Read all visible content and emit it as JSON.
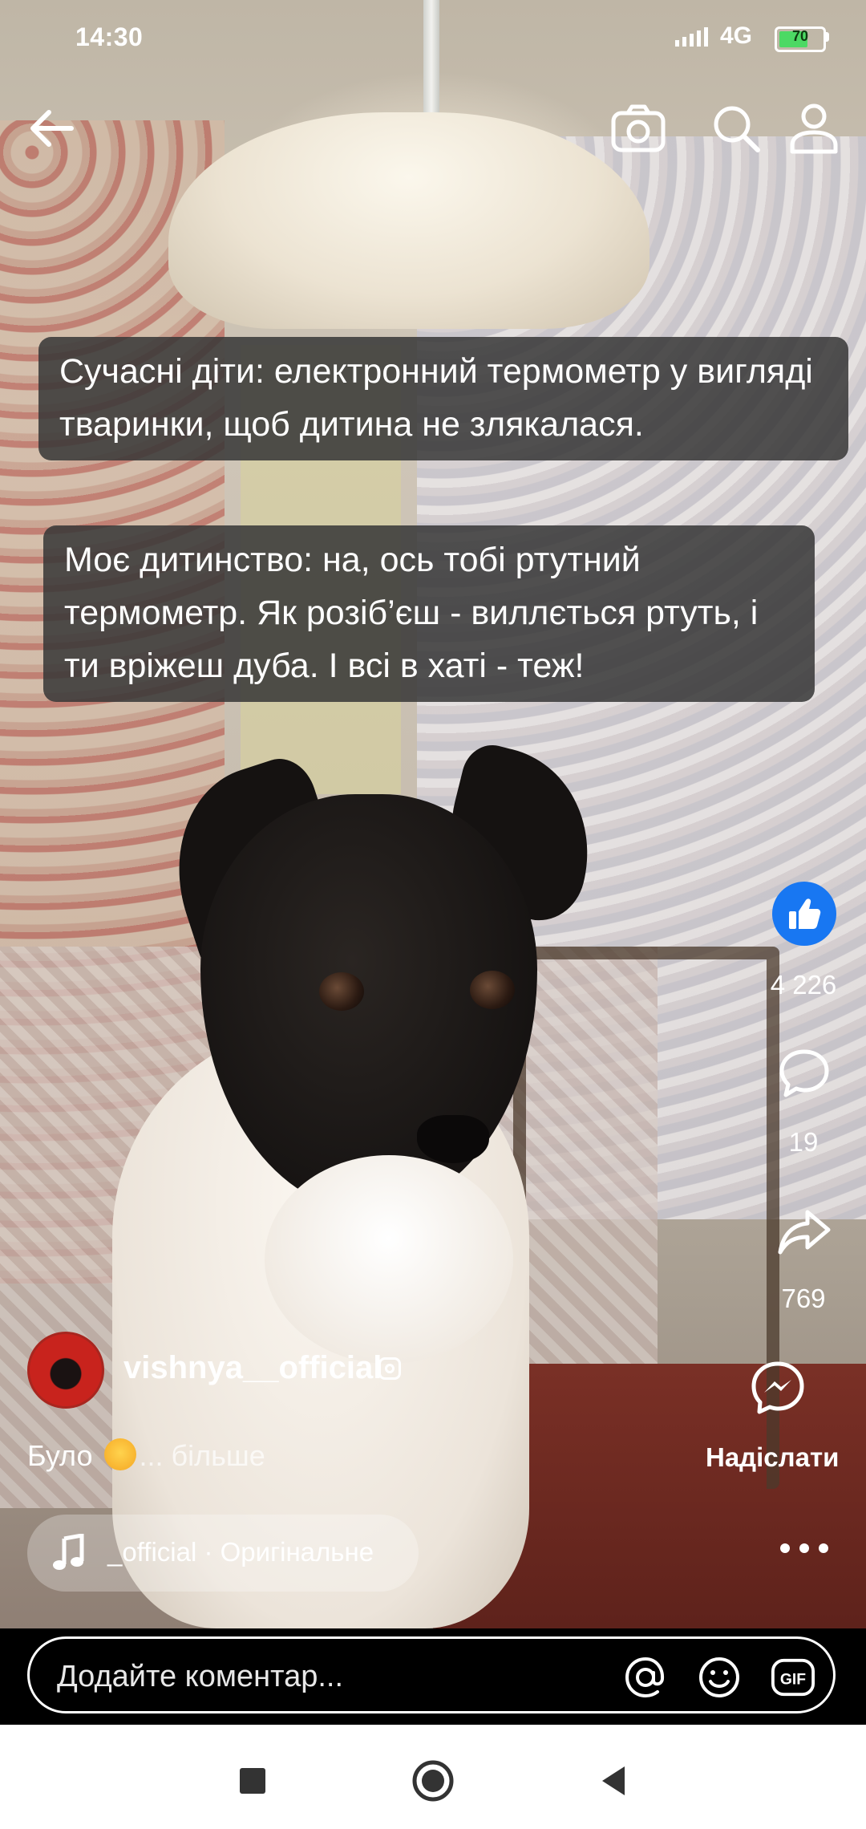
{
  "status_bar": {
    "time": "14:30",
    "network": "4G",
    "battery_level": "70",
    "battery_color": "#4cd964"
  },
  "top_nav": {
    "back_icon": "arrow-left-icon",
    "camera_icon": "camera-icon",
    "search_icon": "search-icon",
    "profile_icon": "person-icon"
  },
  "video": {
    "caption_1": "Сучасні діти: електронний термометр у вигляді тваринки, щоб дитина не злякалася.",
    "caption_2": "Моє дитинство: на, ось тобі ртутний термометр. Як розіб’єш - виллється ртуть, і ти вріжеш дуба. І всі в хаті - теж!"
  },
  "actions": {
    "like_count": "4 226",
    "comment_count": "19",
    "share_count": "769",
    "send_label": "Надіслати",
    "like_color": "#1877f2"
  },
  "post": {
    "username": "vishnya__official",
    "description_prefix": "Було",
    "description_more": "... більше",
    "music_text": "_official · Оригінальне"
  },
  "comment_bar": {
    "placeholder": "Додайте коментар...",
    "gif_label": "GIF"
  }
}
